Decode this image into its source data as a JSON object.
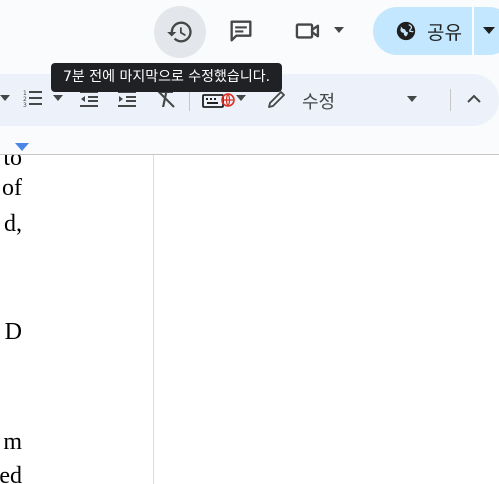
{
  "header": {
    "history_tooltip": "7분 전에 마지막으로 수정했습니다.",
    "share_label": "공유"
  },
  "toolbar": {
    "edit_mode_label": "수정"
  },
  "document": {
    "text_fragments": [
      "to",
      "of",
      "d,",
      "D",
      "m",
      "ed"
    ]
  },
  "colors": {
    "share_bg": "#c2e7ff",
    "toolbar_bg": "#edf2fa",
    "history_hover": "#e3e6ea",
    "ruler_marker": "#4a86e8",
    "tooltip_bg": "#202124"
  },
  "icons": [
    "history-icon",
    "comments-icon",
    "video-call-icon",
    "globe-icon",
    "numbered-list-icon",
    "decrease-indent-icon",
    "increase-indent-icon",
    "clear-formatting-icon",
    "input-tools-icon",
    "pencil-icon",
    "chevron-up-icon"
  ]
}
